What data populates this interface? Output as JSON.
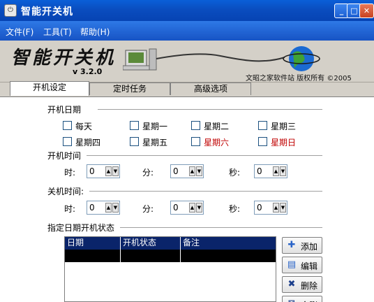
{
  "window": {
    "title": "智能开关机"
  },
  "menu": [
    "文件(F)",
    "工具(T)",
    "帮助(H)"
  ],
  "banner": {
    "logo": "智能开关机",
    "version": "v 3.2.0",
    "copyright": "文昭之家软件站  版权所有  ©2005"
  },
  "tabs": [
    "开机设定",
    "定时任务",
    "高级选项"
  ],
  "startup_dates": {
    "label": "开机日期",
    "days": [
      {
        "label": "每天",
        "checked": false
      },
      {
        "label": "星期一",
        "checked": false
      },
      {
        "label": "星期二",
        "checked": false
      },
      {
        "label": "星期三",
        "checked": false
      },
      {
        "label": "星期四",
        "checked": false
      },
      {
        "label": "星期五",
        "checked": false
      },
      {
        "label": "星期六",
        "checked": false,
        "color": "#c00000"
      },
      {
        "label": "星期日",
        "checked": false,
        "color": "#c00000"
      }
    ]
  },
  "startup_time": {
    "label": "开机时间",
    "hour_label": "时:",
    "minute_label": "分:",
    "second_label": "秒:",
    "hour": "0",
    "minute": "0",
    "second": "0"
  },
  "shutdown_time": {
    "label": "关机时间:",
    "hour_label": "时:",
    "minute_label": "分:",
    "second_label": "秒:",
    "hour": "0",
    "minute": "0",
    "second": "0"
  },
  "status_table": {
    "label": "指定日期开机状态",
    "columns": [
      "日期",
      "开机状态",
      "备注"
    ]
  },
  "buttons": {
    "add": "添加",
    "edit": "编辑",
    "delete": "删除",
    "clear": "全删"
  }
}
